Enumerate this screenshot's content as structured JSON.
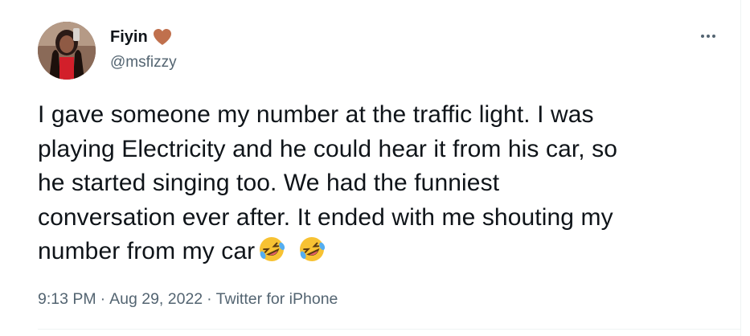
{
  "author": {
    "display_name": "Fiyin",
    "handle": "@msfizzy",
    "name_emoji": "brown-heart-icon",
    "avatar_icon": "avatar-photo"
  },
  "tweet": {
    "lines": [
      "I gave someone my number at the traffic light. I was",
      "playing Electricity and he could hear it from his car, so",
      "he started singing too. We had the funniest",
      "conversation ever after. It ended with me shouting my",
      "number from my car"
    ],
    "trailing_emojis": [
      "rolling-on-floor-laughing-icon",
      "rolling-on-floor-laughing-icon"
    ]
  },
  "meta": {
    "time": "9:13 PM",
    "separator": "·",
    "date": "Aug 29, 2022",
    "source": "Twitter for iPhone"
  },
  "colors": {
    "text_primary": "#0f1419",
    "text_secondary": "#536471",
    "heart": "#c0704d",
    "divider": "#eff3f4"
  },
  "more_icon": "more-horizontal-icon"
}
